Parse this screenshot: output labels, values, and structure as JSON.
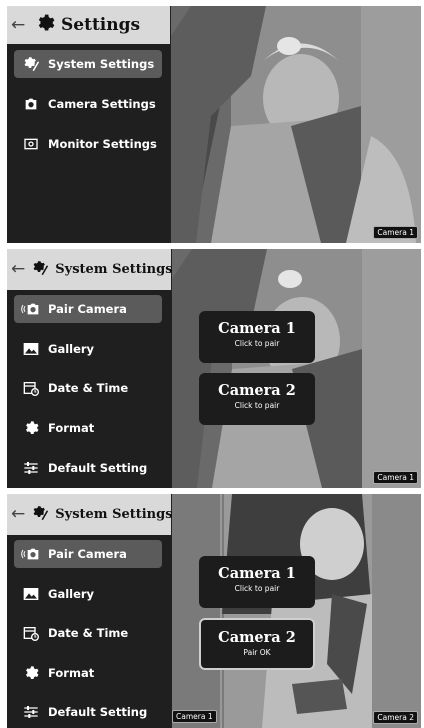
{
  "panel1": {
    "header": {
      "title": "Settings"
    },
    "menu": [
      {
        "label": "System Settings",
        "icon": "system-settings-icon",
        "selected": true
      },
      {
        "label": "Camera Settings",
        "icon": "camera-icon",
        "selected": false
      },
      {
        "label": "Monitor Settings",
        "icon": "monitor-icon",
        "selected": false
      }
    ],
    "camera_tag": "Camera 1"
  },
  "panel2": {
    "header": {
      "title": "System Settings"
    },
    "menu": [
      {
        "label": "Pair Camera",
        "icon": "pair-camera-icon",
        "selected": true
      },
      {
        "label": "Gallery",
        "icon": "gallery-icon",
        "selected": false
      },
      {
        "label": "Date & Time",
        "icon": "calendar-clock-icon",
        "selected": false
      },
      {
        "label": "Format",
        "icon": "format-gear-icon",
        "selected": false
      },
      {
        "label": "Default Setting",
        "icon": "sliders-icon",
        "selected": false
      }
    ],
    "pair_buttons": [
      {
        "title": "Camera 1",
        "subtitle": "Click to pair"
      },
      {
        "title": "Camera 2",
        "subtitle": "Click to pair"
      }
    ],
    "camera_tag": "Camera 1"
  },
  "panel3": {
    "header": {
      "title": "System Settings"
    },
    "menu": [
      {
        "label": "Pair Camera",
        "icon": "pair-camera-icon",
        "selected": true
      },
      {
        "label": "Gallery",
        "icon": "gallery-icon",
        "selected": false
      },
      {
        "label": "Date & Time",
        "icon": "calendar-clock-icon",
        "selected": false
      },
      {
        "label": "Format",
        "icon": "format-gear-icon",
        "selected": false
      },
      {
        "label": "Default Setting",
        "icon": "sliders-icon",
        "selected": false
      }
    ],
    "pair_buttons": [
      {
        "title": "Camera 1",
        "subtitle": "Click to pair"
      },
      {
        "title": "Camera 2",
        "subtitle": "Pair OK"
      }
    ],
    "camera_tags": [
      "Camera 1",
      "Camera 2"
    ]
  },
  "colors": {
    "sidebar": "#1f1f1f",
    "header": "#d9d9d9",
    "selected": "#5b5b5b",
    "button": "#1c1c1c"
  }
}
